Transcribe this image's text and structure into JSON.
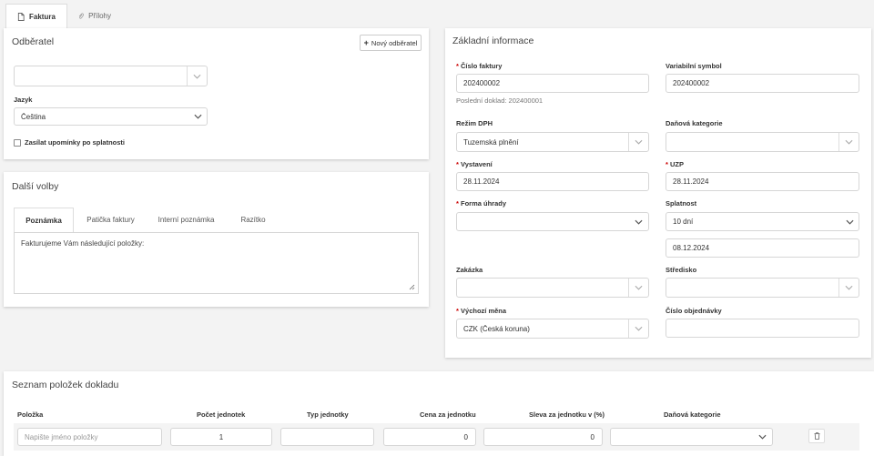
{
  "tabs": [
    {
      "label": "Faktura",
      "icon": "document-icon",
      "active": true
    },
    {
      "label": "Přílohy",
      "icon": "paperclip-icon",
      "active": false
    }
  ],
  "customer": {
    "title": "Odběratel",
    "new_button": "Nový odběratel",
    "select_value": "",
    "language_label": "Jazyk",
    "language_value": "Čeština",
    "reminder_checkbox": "Zasílat upomínky po splatnosti",
    "reminder_checked": false
  },
  "options": {
    "title": "Další volby",
    "tabs": [
      "Poznámka",
      "Patička faktury",
      "Interní poznámka",
      "Razítko"
    ],
    "active_tab": 0,
    "note_text": "Fakturujeme Vám následující položky:"
  },
  "basic": {
    "title": "Základní informace",
    "invoice_number_label": "Číslo faktury",
    "invoice_number": "202400002",
    "last_document": "Poslední doklad: 202400001",
    "var_symbol_label": "Variabilní symbol",
    "var_symbol": "202400002",
    "vat_mode_label": "Režim DPH",
    "vat_mode": "Tuzemská plnění",
    "tax_category_label": "Daňová kategorie",
    "tax_category": "",
    "issued_label": "Vystavení",
    "issued": "28.11.2024",
    "uzp_label": "UZP",
    "uzp": "28.11.2024",
    "payment_label": "Forma úhrady",
    "payment": "",
    "due_label": "Splatnost",
    "due": "10 dní",
    "due_date": "08.12.2024",
    "order_label": "Zakázka",
    "order": "",
    "center_label": "Středisko",
    "center": "",
    "currency_label": "Výchozí měna",
    "currency": "CZK (Česká koruna)",
    "purchase_order_label": "Číslo objednávky",
    "purchase_order": ""
  },
  "items": {
    "title": "Seznam položek dokladu",
    "columns": [
      "Položka",
      "Počet jednotek",
      "Typ jednotky",
      "Cena za jednotku",
      "Sleva za jednotku v (%)",
      "Daňová kategorie"
    ],
    "row": {
      "name_placeholder": "Napište jméno položky",
      "quantity": "1",
      "unit": "",
      "price": "0",
      "discount": "0",
      "tax_category": ""
    }
  },
  "required_marker": "*"
}
